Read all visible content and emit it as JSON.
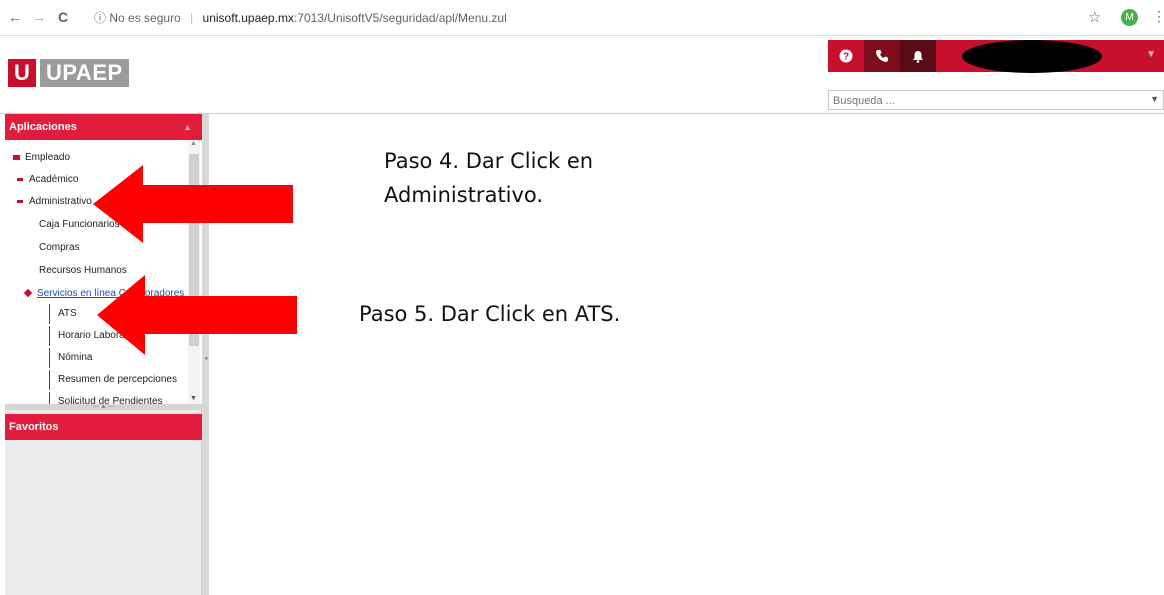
{
  "browser": {
    "back": "←",
    "forward": "→",
    "reload": "C",
    "info_icon": "ⓘ",
    "security_text": "No es seguro",
    "url_host": "unisoft.upaep.mx",
    "url_path": ":7013/UnisoftV5/seguridad/apl/Menu.zul",
    "star": "☆",
    "profile_initial": "M",
    "menu": "⋮"
  },
  "header": {
    "logo_mark": "U",
    "logo_text": "UPAEP",
    "tools": {
      "help": "?",
      "phone": "☏",
      "bell": "♟"
    },
    "search_placeholder": "Busqueda ..."
  },
  "sidebar": {
    "aplicaciones_title": "Aplicaciones",
    "favoritos_title": "Favoritos",
    "tree": {
      "empleado": "Empleado",
      "academico": "Académico",
      "administrativo": "Administrativo",
      "caja": "Caja Funcionarios",
      "compras": "Compras",
      "rh": "Recursos Humanos",
      "servicios": "Servicios en línea Colaboradores",
      "sub": [
        "ATS",
        "Horario Laboral",
        "Nómina",
        "Resumen de percepciones",
        "Solicitud de Pendientes"
      ]
    }
  },
  "instructions": {
    "paso4_line1": "Paso 4. Dar Click en",
    "paso4_line2": "Administrativo.",
    "paso5": "Paso 5. Dar Click en ATS."
  },
  "colors": {
    "brand_red": "#c8102e",
    "panel_red": "#e21c3c",
    "arrow_red": "#ff0000",
    "logo_grey": "#9b9b9b"
  }
}
